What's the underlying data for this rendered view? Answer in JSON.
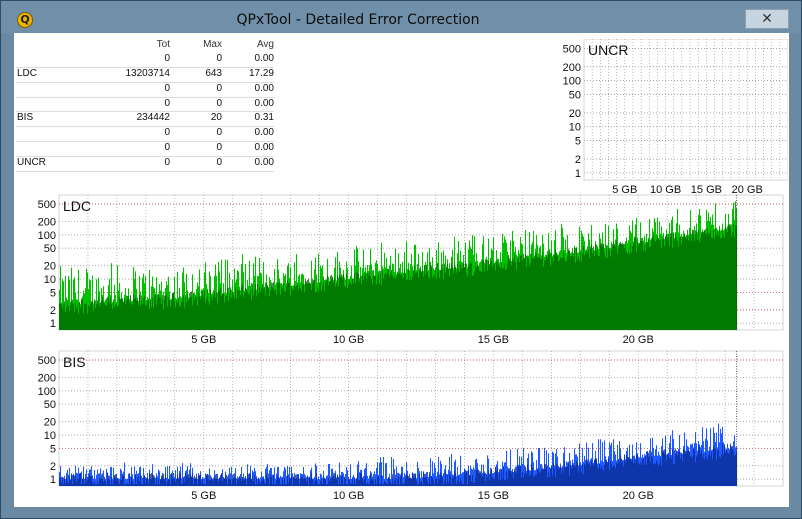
{
  "window": {
    "title": "QPxTool - Detailed Error Correction",
    "close_glyph": "✕",
    "app_icon_glyph": "Q"
  },
  "stats": {
    "headers": {
      "tot": "Tot",
      "max": "Max",
      "avg": "Avg"
    },
    "rows": [
      {
        "label": "",
        "tot": "0",
        "max": "0",
        "avg": "0.00"
      },
      {
        "label": "LDC",
        "tot": "13203714",
        "max": "643",
        "avg": "17.29"
      },
      {
        "label": "",
        "tot": "0",
        "max": "0",
        "avg": "0.00"
      },
      {
        "label": "",
        "tot": "0",
        "max": "0",
        "avg": "0.00"
      },
      {
        "label": "BIS",
        "tot": "234442",
        "max": "20",
        "avg": "0.31"
      },
      {
        "label": "",
        "tot": "0",
        "max": "0",
        "avg": "0.00"
      },
      {
        "label": "",
        "tot": "0",
        "max": "0",
        "avg": "0.00"
      },
      {
        "label": "UNCR",
        "tot": "0",
        "max": "0",
        "avg": "0.00"
      }
    ]
  },
  "chart_data": [
    {
      "type": "bar",
      "title": "UNCR",
      "y_scale": "log",
      "y_ticks": [
        "1",
        "2",
        "5",
        "10",
        "20",
        "50",
        "100",
        "200",
        "500"
      ],
      "y_ticks_values": [
        1,
        2,
        5,
        10,
        20,
        50,
        100,
        200,
        500
      ],
      "x_ticks": [
        "5 GB",
        "10 GB",
        "15 GB",
        "20 GB"
      ],
      "x_ticks_values": [
        5,
        10,
        15,
        20
      ],
      "xlim": [
        0,
        25
      ],
      "values": [],
      "colors": {
        "fill": "#00b800",
        "grid": "#8c8c8c",
        "threshold": "#b22222"
      }
    },
    {
      "type": "bar",
      "title": "LDC",
      "y_scale": "log",
      "y_ticks": [
        "1",
        "2",
        "5",
        "10",
        "20",
        "50",
        "100",
        "200",
        "500"
      ],
      "y_ticks_values": [
        1,
        2,
        5,
        10,
        20,
        50,
        100,
        200,
        500
      ],
      "x_ticks": [
        "5 GB",
        "10 GB",
        "15 GB",
        "20 GB"
      ],
      "x_ticks_values": [
        5,
        10,
        15,
        20
      ],
      "xlim": [
        0,
        25
      ],
      "data_end_gb": 23.4,
      "x": [
        0,
        2,
        4,
        6,
        8,
        10,
        12,
        14,
        16,
        18,
        20,
        22,
        23.4
      ],
      "avg": [
        2.5,
        3,
        3.5,
        5,
        7,
        10,
        14,
        18,
        28,
        40,
        65,
        100,
        140
      ],
      "peak": [
        20,
        22,
        25,
        30,
        40,
        55,
        70,
        90,
        120,
        170,
        260,
        380,
        643
      ],
      "threshold_lines": [
        2,
        5,
        500
      ],
      "colors": {
        "fill": "#00c000",
        "dark": "#006400",
        "grid": "#8c8c8c",
        "threshold": "#b22222"
      }
    },
    {
      "type": "bar",
      "title": "BIS",
      "y_scale": "log",
      "y_ticks": [
        "1",
        "2",
        "5",
        "10",
        "20",
        "50",
        "100",
        "200",
        "500"
      ],
      "y_ticks_values": [
        1,
        2,
        5,
        10,
        20,
        50,
        100,
        200,
        500
      ],
      "x_ticks": [
        "5 GB",
        "10 GB",
        "15 GB",
        "20 GB"
      ],
      "x_ticks_values": [
        5,
        10,
        15,
        20
      ],
      "xlim": [
        0,
        25
      ],
      "data_end_gb": 23.4,
      "x": [
        0,
        2,
        4,
        6,
        8,
        10,
        12,
        14,
        16,
        18,
        20,
        22,
        23.4
      ],
      "avg": [
        1,
        1,
        1,
        1,
        1,
        1,
        1,
        1.2,
        1.5,
        2,
        3,
        4,
        5
      ],
      "peak": [
        2,
        2,
        2,
        2,
        2,
        2.5,
        3,
        4,
        5,
        7,
        10,
        14,
        20
      ],
      "threshold_lines": [
        5,
        500
      ],
      "colors": {
        "fill": "#1e5aff",
        "dark": "#0a2a8c",
        "grid": "#8c8c8c",
        "threshold": "#b22222"
      }
    }
  ]
}
